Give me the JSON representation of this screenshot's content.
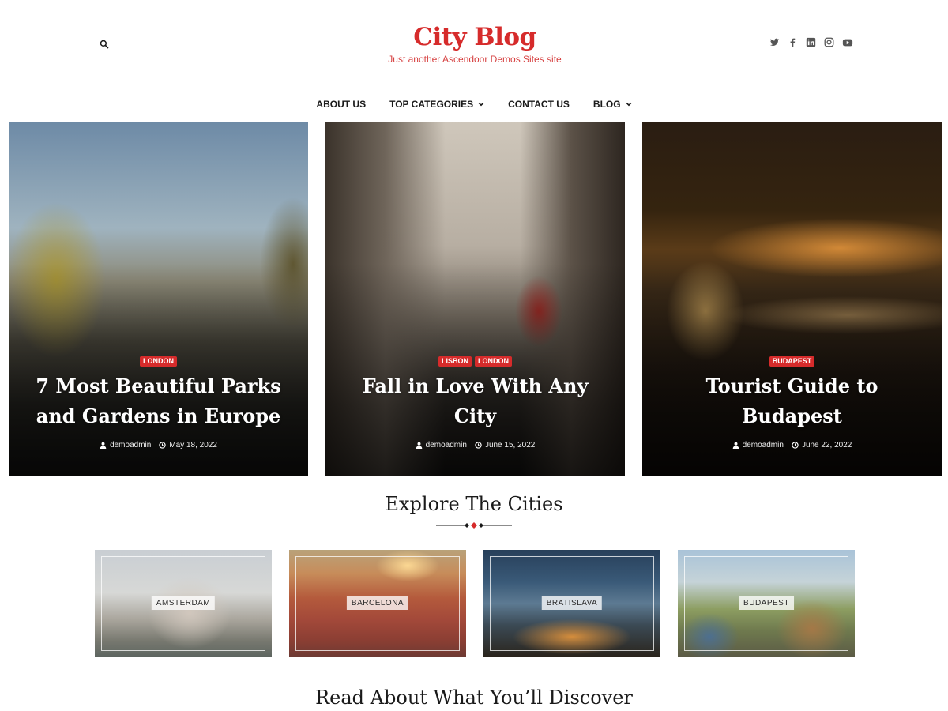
{
  "header": {
    "site_title": "City Blog",
    "tagline": "Just another Ascendoor Demos Sites site",
    "social_icons": [
      "twitter-icon",
      "facebook-icon",
      "linkedin-icon",
      "instagram-icon",
      "youtube-icon"
    ]
  },
  "nav": {
    "items": [
      {
        "label": "ABOUT US",
        "dropdown": false
      },
      {
        "label": "TOP CATEGORIES",
        "dropdown": true
      },
      {
        "label": "CONTACT US",
        "dropdown": false
      },
      {
        "label": "BLOG",
        "dropdown": true
      }
    ]
  },
  "posts": [
    {
      "tags": [
        "LONDON"
      ],
      "title": "7 Most Beautiful Parks and Gardens in Europe",
      "author": "demoadmin",
      "date": "May 18, 2022"
    },
    {
      "tags": [
        "LISBON",
        "LONDON"
      ],
      "title": "Fall in Love With Any City",
      "author": "demoadmin",
      "date": "June 15, 2022"
    },
    {
      "tags": [
        "BUDAPEST"
      ],
      "title": "Tourist Guide to Budapest",
      "author": "demoadmin",
      "date": "June 22, 2022"
    }
  ],
  "explore": {
    "title": "Explore The Cities",
    "cities": [
      "AMSTERDAM",
      "BARCELONA",
      "BRATISLAVA",
      "BUDAPEST"
    ]
  },
  "discover": {
    "title": "Read About What You’ll Discover"
  },
  "colors": {
    "accent": "#d62b2b",
    "text": "#1a1a1a"
  }
}
